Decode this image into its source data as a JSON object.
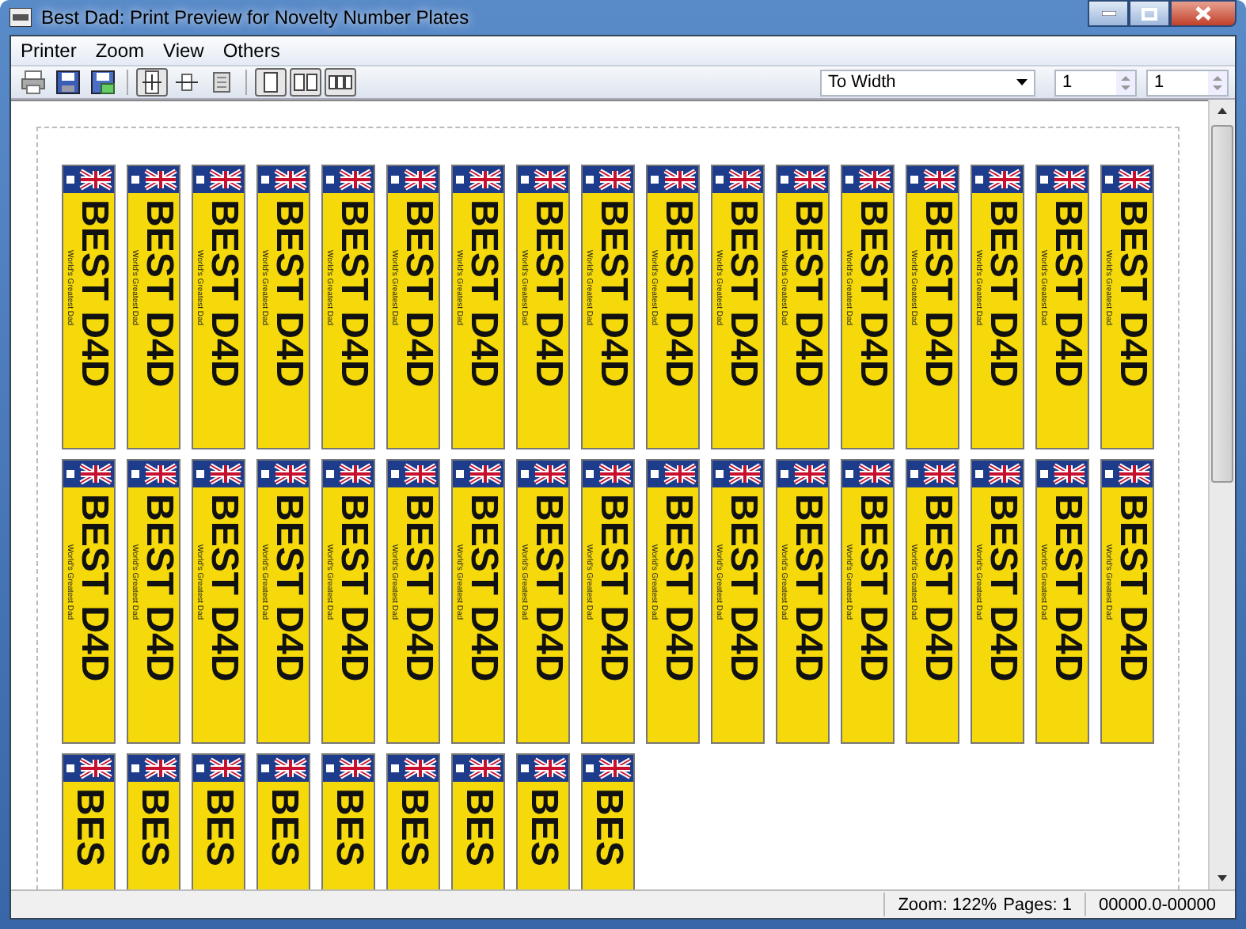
{
  "window": {
    "title": "Best Dad: Print Preview for Novelty Number Plates"
  },
  "menu": [
    {
      "label": "Printer"
    },
    {
      "label": "Zoom"
    },
    {
      "label": "View"
    },
    {
      "label": "Others"
    }
  ],
  "toolbar": [
    {
      "kind": "print",
      "pressed": false
    },
    {
      "kind": "save",
      "pressed": false
    },
    {
      "kind": "save-as",
      "pressed": false
    },
    {
      "kind": "sep"
    },
    {
      "kind": "fit-page",
      "pressed": true
    },
    {
      "kind": "fit-width",
      "pressed": false
    },
    {
      "kind": "actual",
      "pressed": false
    },
    {
      "kind": "sep"
    },
    {
      "kind": "one-page",
      "pressed": true
    },
    {
      "kind": "two-pages",
      "pressed": true
    },
    {
      "kind": "many-pages",
      "pressed": true
    }
  ],
  "zoom_select": {
    "value": "To Width"
  },
  "spinners": [
    {
      "value": "1"
    },
    {
      "value": "1"
    }
  ],
  "sheet": {
    "rows": [
      {
        "plates": [
          {
            "text": "BEST D4D",
            "caption": "World's Greatest Dad"
          },
          {
            "text": "BEST D4D",
            "caption": "World's Greatest Dad"
          },
          {
            "text": "BEST D4D",
            "caption": "World's Greatest Dad"
          },
          {
            "text": "BEST D4D",
            "caption": "World's Greatest Dad"
          },
          {
            "text": "BEST D4D",
            "caption": "World's Greatest Dad"
          },
          {
            "text": "BEST D4D",
            "caption": "World's Greatest Dad"
          },
          {
            "text": "BEST D4D",
            "caption": "World's Greatest Dad"
          },
          {
            "text": "BEST D4D",
            "caption": "World's Greatest Dad"
          },
          {
            "text": "BEST D4D",
            "caption": "World's Greatest Dad"
          },
          {
            "text": "BEST D4D",
            "caption": "World's Greatest Dad"
          },
          {
            "text": "BEST D4D",
            "caption": "World's Greatest Dad"
          },
          {
            "text": "BEST D4D",
            "caption": "World's Greatest Dad"
          },
          {
            "text": "BEST D4D",
            "caption": "World's Greatest Dad"
          },
          {
            "text": "BEST D4D",
            "caption": "World's Greatest Dad"
          },
          {
            "text": "BEST D4D",
            "caption": "World's Greatest Dad"
          },
          {
            "text": "BEST D4D",
            "caption": "World's Greatest Dad"
          },
          {
            "text": "BEST D4D",
            "caption": "World's Greatest Dad"
          }
        ]
      },
      {
        "plates": [
          {
            "text": "BEST D4D",
            "caption": "World's Greatest Dad"
          },
          {
            "text": "BEST D4D",
            "caption": "World's Greatest Dad"
          },
          {
            "text": "BEST D4D",
            "caption": "World's Greatest Dad"
          },
          {
            "text": "BEST D4D",
            "caption": "World's Greatest Dad"
          },
          {
            "text": "BEST D4D",
            "caption": "World's Greatest Dad"
          },
          {
            "text": "BEST D4D",
            "caption": "World's Greatest Dad"
          },
          {
            "text": "BEST D4D",
            "caption": "World's Greatest Dad"
          },
          {
            "text": "BEST D4D",
            "caption": "World's Greatest Dad"
          },
          {
            "text": "BEST D4D",
            "caption": "World's Greatest Dad"
          },
          {
            "text": "BEST D4D",
            "caption": "World's Greatest Dad"
          },
          {
            "text": "BEST D4D",
            "caption": "World's Greatest Dad"
          },
          {
            "text": "BEST D4D",
            "caption": "World's Greatest Dad"
          },
          {
            "text": "BEST D4D",
            "caption": "World's Greatest Dad"
          },
          {
            "text": "BEST D4D",
            "caption": "World's Greatest Dad"
          },
          {
            "text": "BEST D4D",
            "caption": "World's Greatest Dad"
          },
          {
            "text": "BEST D4D",
            "caption": "World's Greatest Dad"
          },
          {
            "text": "BEST D4D",
            "caption": "World's Greatest Dad"
          }
        ]
      },
      {
        "plates": [
          {
            "text": "BES"
          },
          {
            "text": "BES"
          },
          {
            "text": "BES"
          },
          {
            "text": "BES"
          },
          {
            "text": "BES"
          },
          {
            "text": "BES"
          },
          {
            "text": "BES"
          },
          {
            "text": "BES"
          },
          {
            "text": "BES"
          }
        ]
      }
    ]
  },
  "status_bar": {
    "zoom": "Zoom: 122%",
    "pages": "Pages: 1",
    "coords": "00000.0-00000"
  }
}
